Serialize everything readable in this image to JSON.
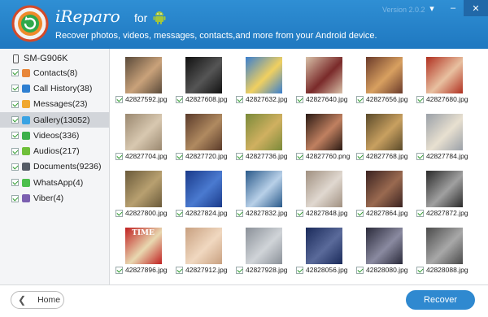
{
  "header": {
    "app_name": "iReparo",
    "for_label": "for",
    "subtitle": "Recover photos, videos, messages, contacts,and more from your Android device.",
    "version": "Version 2.0.2",
    "window_buttons": [
      "▾",
      "–",
      "✕"
    ]
  },
  "sidebar": {
    "device": "SM-G906K",
    "categories": [
      {
        "label": "Contacts(8)",
        "icon": "contacts-icon",
        "color": "#e8863a"
      },
      {
        "label": "Call History(38)",
        "icon": "call-history-icon",
        "color": "#2e7fd1"
      },
      {
        "label": "Messages(23)",
        "icon": "messages-icon",
        "color": "#f0a830"
      },
      {
        "label": "Gallery(13052)",
        "icon": "gallery-icon",
        "color": "#3aa3e3",
        "active": true
      },
      {
        "label": "Videos(336)",
        "icon": "videos-icon",
        "color": "#3bb04a"
      },
      {
        "label": "Audios(217)",
        "icon": "audios-icon",
        "color": "#6fbf3a"
      },
      {
        "label": "Documents(9236)",
        "icon": "documents-icon",
        "color": "#555c66"
      },
      {
        "label": "WhatsApp(4)",
        "icon": "whatsapp-icon",
        "color": "#4cbf4c"
      },
      {
        "label": "Viber(4)",
        "icon": "viber-icon",
        "color": "#7b5fb0"
      }
    ]
  },
  "gallery": {
    "files": [
      "42827592.jpg",
      "42827608.jpg",
      "42827632.jpg",
      "42827640.jpg",
      "42827656.jpg",
      "42827680.jpg",
      "42827704.jpg",
      "42827720.jpg",
      "42827736.jpg",
      "42827760.png",
      "42827768.jpg",
      "42827784.jpg",
      "42827800.jpg",
      "42827824.jpg",
      "42827832.jpg",
      "42827848.jpg",
      "42827864.jpg",
      "42827872.jpg",
      "42827896.jpg",
      "42827912.jpg",
      "42827928.jpg",
      "42828056.jpg",
      "42828080.jpg",
      "42828088.jpg"
    ],
    "thumb_colors": [
      [
        "#5a4a3a",
        "#c9a27a"
      ],
      [
        "#111111",
        "#555555"
      ],
      [
        "#3a7fcf",
        "#f0d060"
      ],
      [
        "#d8c0a8",
        "#7a2a2a"
      ],
      [
        "#6a3a2a",
        "#d8a060"
      ],
      [
        "#b03020",
        "#e8c0a0"
      ],
      [
        "#9a8870",
        "#d8c8b0"
      ],
      [
        "#5a3a2a",
        "#b08a60"
      ],
      [
        "#7a8a3a",
        "#d0b060"
      ],
      [
        "#2a1a14",
        "#c08060"
      ],
      [
        "#5a4a2a",
        "#c8a060"
      ],
      [
        "#9aa0a8",
        "#e8e0d0"
      ],
      [
        "#6a5a3a",
        "#b8a070"
      ],
      [
        "#1a3a8a",
        "#4a7ad0"
      ],
      [
        "#2a5a8a",
        "#b8d0e8"
      ],
      [
        "#a09080",
        "#e0d8d0"
      ],
      [
        "#3a2220",
        "#9a6a50"
      ],
      [
        "#2a2a2a",
        "#a0a0a0"
      ],
      [
        "#c02020",
        "#e8d8b0"
      ],
      [
        "#c8a080",
        "#f0d8c0"
      ],
      [
        "#8a9098",
        "#d0d4d8"
      ],
      [
        "#1a2a5a",
        "#5a6a9a"
      ],
      [
        "#2a2a3a",
        "#8a8aa0"
      ],
      [
        "#4a4a4a",
        "#a8a8a8"
      ]
    ],
    "text_thumb_label": "TIME"
  },
  "footer": {
    "home_label": "Home",
    "recover_label": "Recover"
  },
  "colors": {
    "header_blue": "#2580c8",
    "accent": "#2f89d0",
    "active_row": "#d2d5da"
  }
}
